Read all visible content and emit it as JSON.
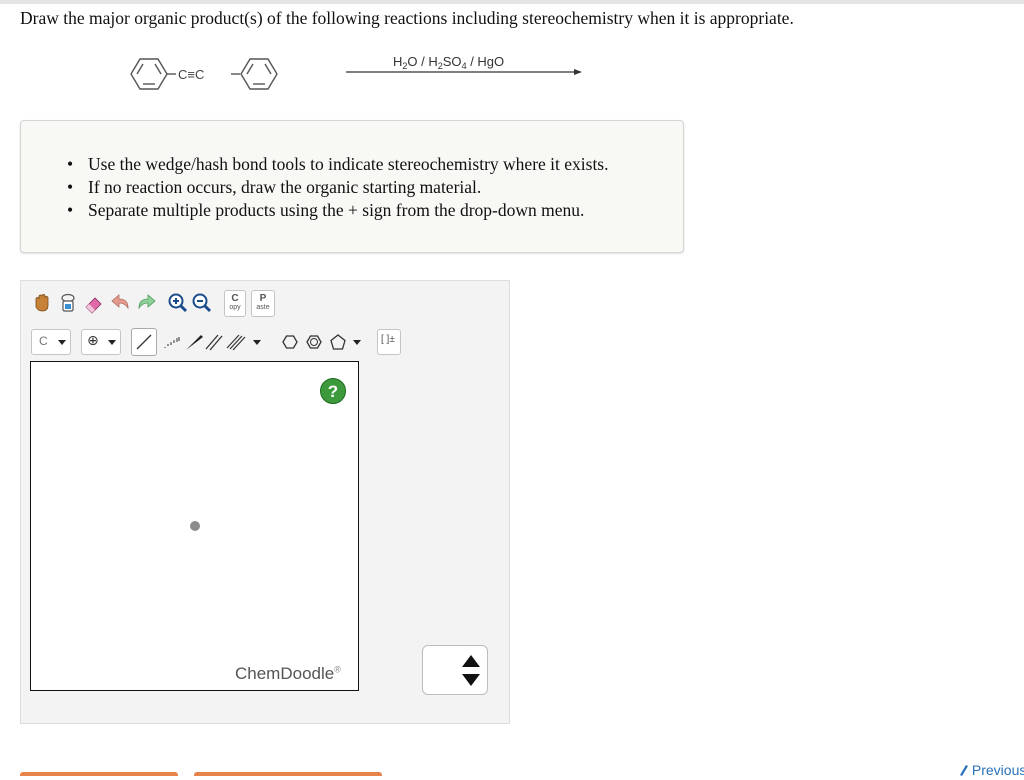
{
  "question": {
    "text": "Draw the major organic product(s) of the following reactions including stereochemistry when it is appropriate."
  },
  "reaction": {
    "alkyne_label": "C≡C",
    "reagents": {
      "h": "H",
      "sub2": "2",
      "o_sep": "O / H",
      "so": "SO",
      "sub4": "4",
      "end": " / HgO"
    }
  },
  "instructions": {
    "bullet": "•",
    "items": [
      "Use the wedge/hash bond tools to indicate stereochemistry where it exists.",
      "If no reaction occurs, draw the organic starting material.",
      "Separate multiple products using the + sign from the drop-down menu."
    ]
  },
  "toolbar": {
    "copy_top": "C",
    "copy_bottom": "opy",
    "paste_top": "P",
    "paste_bottom": "aste",
    "atom_label": "C",
    "charge_symbol": "⊕",
    "bracket_label": "[ ]±"
  },
  "canvas": {
    "help_label": "?",
    "brand": "ChemDoodle",
    "brand_mark": "®"
  },
  "navigation": {
    "previous_label": "Previous"
  },
  "colors": {
    "help_green": "#3c9a3c",
    "bottom_button_orange": "#e8834b",
    "link_blue": "#2a72b8"
  }
}
